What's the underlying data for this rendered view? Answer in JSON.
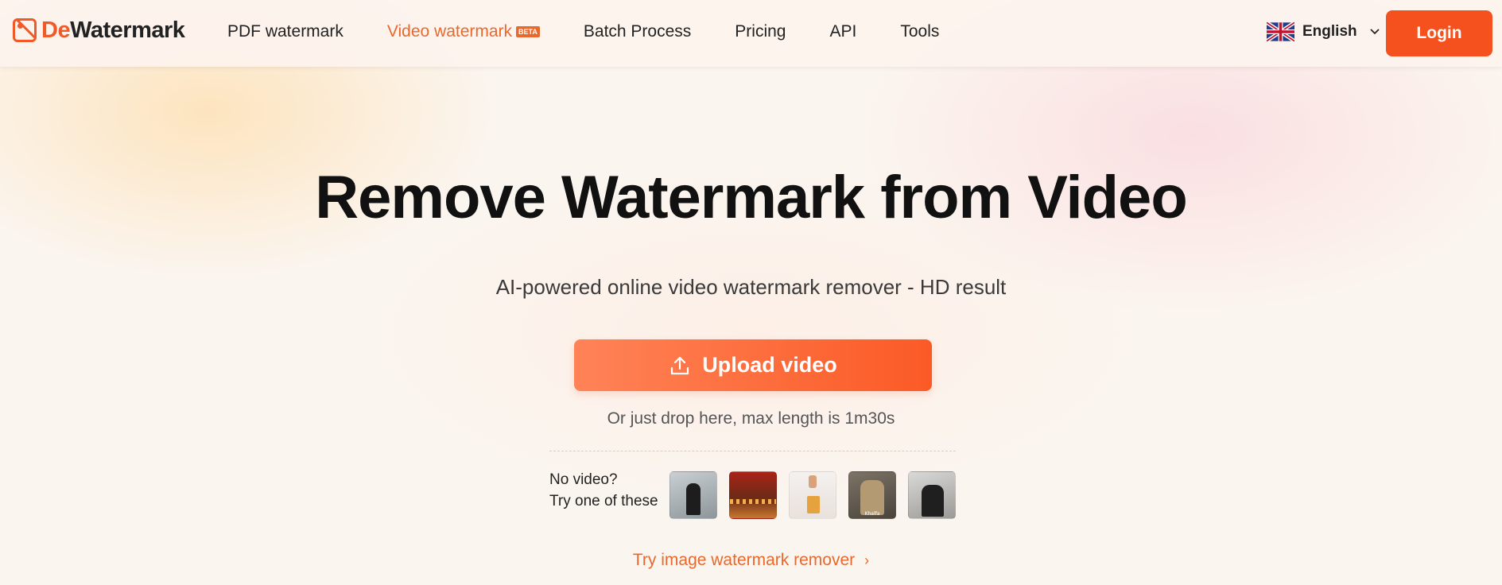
{
  "header": {
    "logo": {
      "prefix": "De",
      "suffix": "Watermark"
    },
    "nav": [
      {
        "label": "PDF watermark"
      },
      {
        "label": "Video watermark",
        "badge": "BETA",
        "active": true
      },
      {
        "label": "Batch Process"
      },
      {
        "label": "Pricing"
      },
      {
        "label": "API"
      },
      {
        "label": "Tools"
      }
    ],
    "language": {
      "label": "English",
      "flag_icon": "uk-flag-icon"
    },
    "login_label": "Login"
  },
  "hero": {
    "title": "Remove Watermark from Video",
    "subtitle": "AI-powered online video watermark remover - HD result",
    "upload_label": "Upload video",
    "drop_hint": "Or just drop here, max length is 1m30s"
  },
  "samples": {
    "label_line1": "No video?",
    "label_line2": "Try one of these",
    "thumbs": [
      {
        "label": ""
      },
      {
        "label": ""
      },
      {
        "label": ""
      },
      {
        "label": "Khalfa"
      },
      {
        "label": ""
      }
    ]
  },
  "try_link": {
    "label": "Try image watermark remover"
  },
  "colors": {
    "accent": "#f4511e",
    "accent_text": "#e8692d",
    "upload_gradient_start": "#ff8357",
    "upload_gradient_end": "#fb5a26"
  }
}
